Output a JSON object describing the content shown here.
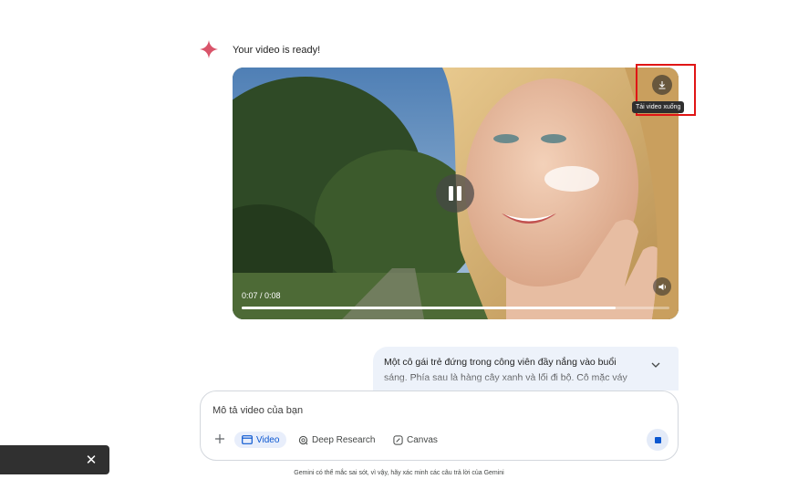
{
  "response": {
    "status_text": "Your video is ready!"
  },
  "video": {
    "time": "0:07 / 0:08",
    "progress": 0.875,
    "download_tooltip": "Tải video xuống"
  },
  "prompt": {
    "text": "Một cô gái trẻ đứng trong công viên đầy nắng vào buổi sáng. Phía sau là hàng cây xanh và lối đi bộ. Cô mặc váy"
  },
  "composer": {
    "placeholder": "Mô tả video của bạn",
    "tools": {
      "video": "Video",
      "deep_research": "Deep Research",
      "canvas": "Canvas"
    }
  },
  "footer": {
    "disclaimer": "Gemini có thể mắc sai sót, vì vậy, hãy xác minh các câu trả lời của Gemini"
  },
  "icons": {
    "sparkle": "gemini-sparkle-icon",
    "pause": "pause-icon",
    "volume": "volume-icon",
    "download": "download-icon",
    "chevron": "chevron-down-icon",
    "plus": "plus-icon",
    "video_tool": "video-icon",
    "deep_research": "deep-research-icon",
    "canvas": "canvas-icon",
    "stop": "stop-icon",
    "close": "close-icon"
  },
  "colors": {
    "accent": "#0b57d0",
    "highlight": "#e01515",
    "sparkle": "#d9546a"
  }
}
